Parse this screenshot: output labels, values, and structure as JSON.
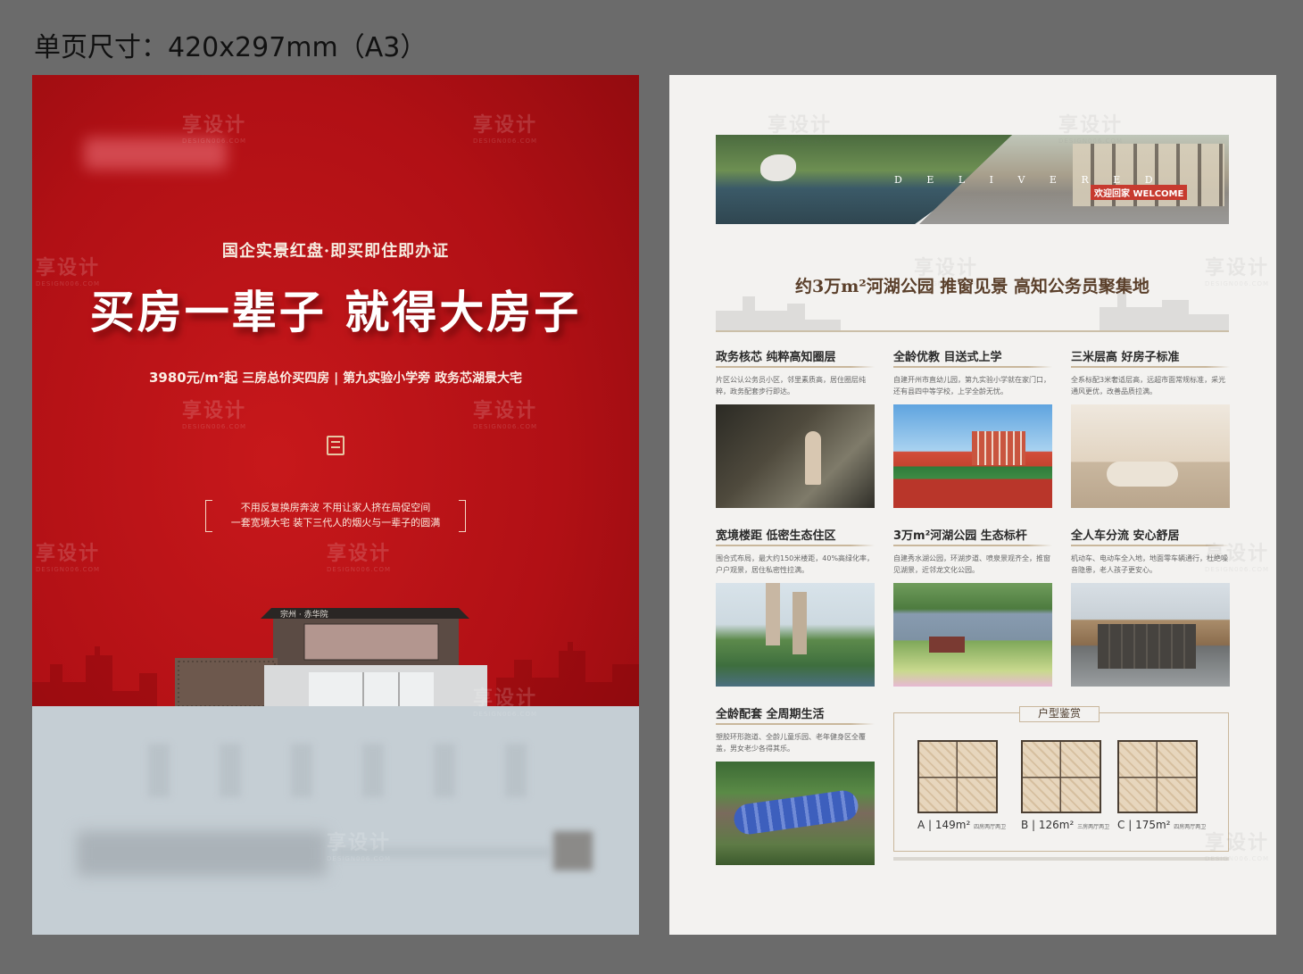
{
  "page_label": "单页尺寸：420x297mm（A3）",
  "front": {
    "tagline": "国企实景红盘·即买即住即办证",
    "headline": "买房一辈子 就得大房子",
    "price": "3980元/m²起",
    "selling_points": "三房总价买四房 | 第九实验小学旁 政务芯湖景大宅",
    "quote_line1": "不用反复换房奔波 不用让家人挤在局促空间",
    "quote_line2": "一套宽境大宅 装下三代人的烟火与一辈子的圆满",
    "building_sign": "宗州 · 赤华院"
  },
  "back": {
    "banner_text": "D E L I V E R E D",
    "banner_sign": "欢迎回家 WELCOME",
    "section_title": "约3万m²河湖公园 推窗见景 高知公务员聚集地",
    "features": [
      {
        "title": "政务核芯 纯粹高知圈层",
        "desc": "片区公认公务员小区，邻里素质高，居住圈层纯粹，政务配套步行即达。"
      },
      {
        "title": "全龄优教 目送式上学",
        "desc": "自建开州市直幼儿园，第九实验小学就在家门口，还有县四中等学校，上学全龄无忧。"
      },
      {
        "title": "三米层高 好房子标准",
        "desc": "全系标配3米奢适层高，远超市面常规标准，采光通风更优，改善品质拉满。"
      },
      {
        "title": "宽境楼距 低密生态住区",
        "desc": "围合式布局，最大约150米楼距，40%高绿化率，户户观景，居住私密性拉满。"
      },
      {
        "title": "3万m²河湖公园 生态标杆",
        "desc": "自建秀水湖公园，环湖步道、喷泉景观齐全，推窗见湖景，近邻龙文化公园。"
      },
      {
        "title": "全人车分流 安心舒居",
        "desc": "机动车、电动车全入地，地面零车辆通行，杜绝噪音隐患，老人孩子更安心。"
      },
      {
        "title": "全龄配套 全周期生活",
        "desc": "塑胶环形跑道、全龄儿童乐园、老年健身区全覆盖，男女老少各得其乐。"
      }
    ],
    "plans_title": "户型鉴赏",
    "plans": [
      {
        "code": "A",
        "area": "149m²",
        "rooms": "四房两厅两卫"
      },
      {
        "code": "B",
        "area": "126m²",
        "rooms": "三房两厅两卫"
      },
      {
        "code": "C",
        "area": "175m²",
        "rooms": "四房两厅两卫"
      }
    ]
  },
  "watermark": {
    "text": "享设计",
    "sub": "DESIGN006.COM"
  },
  "colors": {
    "front_red": "#b11015",
    "accent_gold": "#c9b79c",
    "back_bg": "#f3f2f0"
  }
}
